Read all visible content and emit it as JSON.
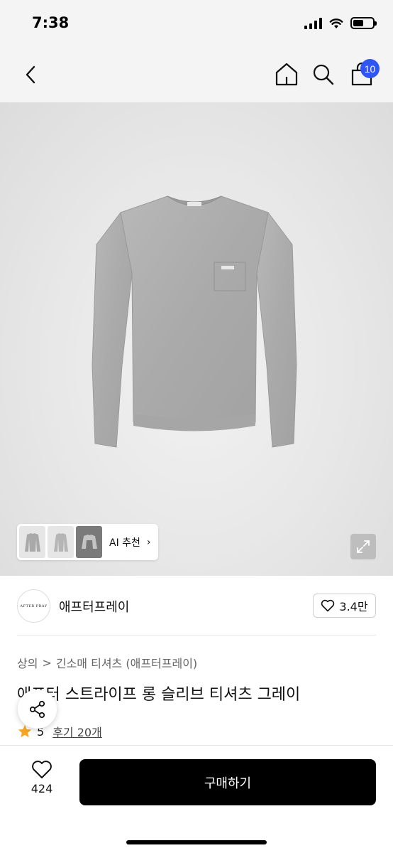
{
  "status_bar": {
    "time": "7:38"
  },
  "header": {
    "cart_count": "10"
  },
  "gallery": {
    "ai_recommend_label": "AI 추천"
  },
  "shop": {
    "logo_text": "AFTER PRAY",
    "name": "애프터프레이",
    "follower_count": "3.4만"
  },
  "breadcrumb": {
    "category": "상의",
    "separator": ">",
    "subcategory": "긴소매 티셔츠 (애프터프레이)"
  },
  "product": {
    "title": "애프터 스트라이프 롱 슬리브 티셔츠 그레이",
    "rating": "5",
    "review_link": "후기 20개"
  },
  "bottom_bar": {
    "like_count": "424",
    "buy_label": "구매하기"
  },
  "colors": {
    "badge": "#2f56f5",
    "star": "#f5a623",
    "buy_button": "#000000"
  }
}
